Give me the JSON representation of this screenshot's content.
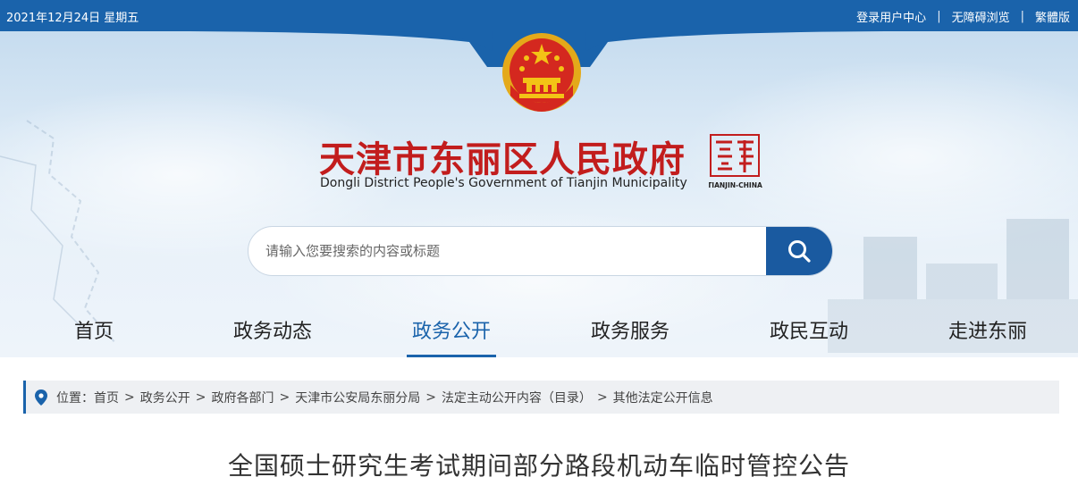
{
  "topbar": {
    "date": "2021年12月24日 星期五",
    "links": [
      "登录用户中心",
      "无障碍浏览",
      "繁體版"
    ],
    "separator": "|"
  },
  "header": {
    "title": "天津市东丽区人民政府",
    "subtitle": "Dongli District People's Government of Tianjin Municipality",
    "seal_text": "TIANJIN-CHINA",
    "search": {
      "placeholder": "请输入您要搜索的内容或标题",
      "button_icon": "search-icon"
    }
  },
  "nav": {
    "items": [
      {
        "label": "首页"
      },
      {
        "label": "政务动态"
      },
      {
        "label": "政务公开",
        "active": true
      },
      {
        "label": "政务服务"
      },
      {
        "label": "政民互动"
      },
      {
        "label": "走进东丽"
      }
    ]
  },
  "breadcrumb": {
    "prefix": "位置：",
    "icon": "location-pin-icon",
    "items": [
      "首页",
      "政务公开",
      "政府各部门",
      "天津市公安局东丽分局",
      "法定主动公开内容（目录）",
      "其他法定公开信息"
    ]
  },
  "article": {
    "title": "全国硕士研究生考试期间部分路段机动车临时管控公告"
  },
  "colors": {
    "topbar": "#1a63ab",
    "title_red": "#c21d1d",
    "accent": "#1a63ab",
    "search_button": "#1a5aa0"
  }
}
